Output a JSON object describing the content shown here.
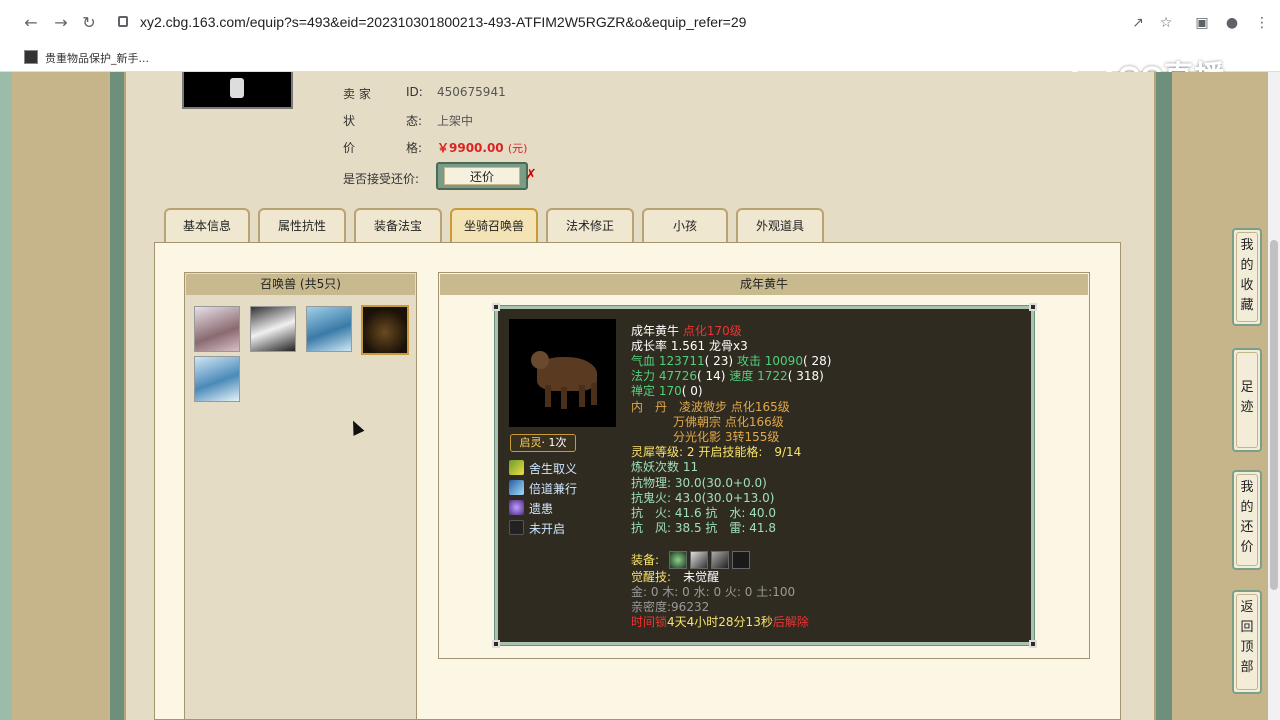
{
  "browser": {
    "url": "xy2.cbg.163.com/equip?s=493&eid=202310301800213-493-ATFIM2W5RGZR&o&equip_refer=29",
    "bookmark": "贵重物品保护_新手...",
    "icons": [
      "back-icon",
      "forward-icon",
      "reload-icon",
      "lock-icon",
      "share-icon",
      "star-icon",
      "sidepanel-icon",
      "profile-icon",
      "menu-icon"
    ]
  },
  "watermark": "CC直播",
  "seller": {
    "seller_label": "卖 家",
    "id_label": "ID:",
    "id_value": "450675941",
    "status_label": "状",
    "status_label2": "态:",
    "status_value": "上架中",
    "price_label": "价",
    "price_label2": "格:",
    "price_value": "￥9900.00",
    "price_unit": "(元)",
    "bargain_label": "是否接受还价:",
    "bargain_button": "还价"
  },
  "tabs": [
    {
      "label": "基本信息",
      "active": false
    },
    {
      "label": "属性抗性",
      "active": false
    },
    {
      "label": "装备法宝",
      "active": false
    },
    {
      "label": "坐骑召唤兽",
      "active": true
    },
    {
      "label": "法术修正",
      "active": false
    },
    {
      "label": "小孩",
      "active": false
    },
    {
      "label": "外观道具",
      "active": false
    }
  ],
  "pet_list": {
    "title": "召唤兽 (共5只)",
    "count": 5,
    "selected_index": 3
  },
  "detail": {
    "title": "成年黄牛",
    "qiling_a": "启灵",
    "qiling_b": "· 1次",
    "skills": [
      "舍生取义",
      "倍道兼行",
      "遗患",
      "未开启"
    ],
    "name": "成年黄牛",
    "level": "点化170级",
    "growth": "成长率 1.561 龙骨x3",
    "hp_label": "气血",
    "hp_value": "123711",
    "hp_extra": "( 23)",
    "atk_label": "攻击",
    "atk_value": "10090",
    "atk_extra": "( 28)",
    "mp_label": "法力",
    "mp_value": "47726",
    "mp_extra": "( 14)",
    "spd_label": "速度",
    "spd_value": "1722",
    "spd_extra": "( 318)",
    "zen_label": "禅定",
    "zen_value": "170",
    "zen_extra": "( 0)",
    "neidan_label": "内　丹",
    "neidan_1": "凌波微步 点化165级",
    "neidan_2": "万佛朝宗 点化166级",
    "neidan_3": "分光化影 3转155级",
    "lingxi_label": "灵犀等级:",
    "lingxi_value": "2 开启技能格:　9/14",
    "lianyao_label": "炼妖次数",
    "lianyao_value": "11",
    "res_phys": "抗物理: 30.0(30.0+0.0)",
    "res_ghost": "抗鬼火: 43.0(30.0+13.0)",
    "res_fire_water": "抗　火: 41.6 抗　水: 40.0",
    "res_wind_thunder": "抗　风: 38.5 抗　雷: 41.8",
    "equip_label": "装备:",
    "awaken_label": "觉醒技:",
    "awaken_value": "未觉醒",
    "elements": "金: 0 木: 0 水: 0 火: 0 土:100",
    "intimacy": "亲密度:96232",
    "lock_a": "时间锁",
    "lock_b": "4天4小时28分13秒",
    "lock_c": "后解除"
  },
  "side_buttons": [
    {
      "label": "我的收藏"
    },
    {
      "label": "足迹"
    },
    {
      "label": "我的还价"
    },
    {
      "label": "返回顶部"
    }
  ]
}
